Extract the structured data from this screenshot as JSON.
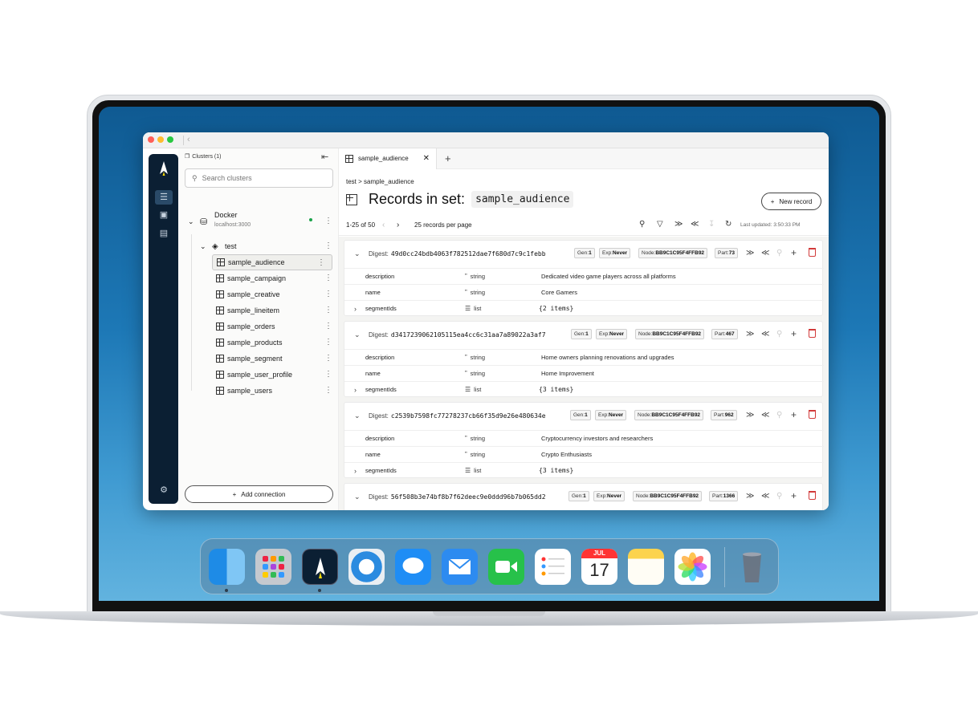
{
  "sidebar": {
    "clusters_label": "Clusters (1)",
    "search_placeholder": "Search clusters",
    "cluster": {
      "name": "Docker",
      "host": "localhost:3000"
    },
    "namespace": "test",
    "sets": [
      "sample_audience",
      "sample_campaign",
      "sample_creative",
      "sample_lineitem",
      "sample_orders",
      "sample_products",
      "sample_segment",
      "sample_user_profile",
      "sample_users"
    ],
    "add_connection": "Add connection"
  },
  "tab": {
    "label": "sample_audience"
  },
  "breadcrumb": "test > sample_audience",
  "header": {
    "title": "Records in set:",
    "set_name": "sample_audience",
    "new_record": "New record"
  },
  "toolbar": {
    "range": "1-25 of 50",
    "per_page": "25 records per page",
    "last_updated": "Last updated: 3:50:33 PM"
  },
  "records": [
    {
      "digest_label": "Digest:",
      "digest": "49d0cc24bdb4063f782512dae7f680d7c9c1febb",
      "gen_label": "Gen:",
      "gen": "1",
      "exp_label": "Exp:",
      "exp": "Never",
      "node_label": "Node:",
      "node": "BB9C1C95F4FFB92",
      "part_label": "Part:",
      "part": "73",
      "bins": [
        {
          "name": "description",
          "type": "string",
          "value": "Dedicated video game players across all platforms"
        },
        {
          "name": "name",
          "type": "string",
          "value": "Core Gamers"
        },
        {
          "name": "segmentIds",
          "type": "list",
          "value": "{2 items}"
        }
      ]
    },
    {
      "digest_label": "Digest:",
      "digest": "d3417239062105115ea4cc6c31aa7a89022a3af7",
      "gen_label": "Gen:",
      "gen": "1",
      "exp_label": "Exp:",
      "exp": "Never",
      "node_label": "Node:",
      "node": "BB9C1C95F4FFB92",
      "part_label": "Part:",
      "part": "467",
      "bins": [
        {
          "name": "description",
          "type": "string",
          "value": "Home owners planning renovations and upgrades"
        },
        {
          "name": "name",
          "type": "string",
          "value": "Home Improvement"
        },
        {
          "name": "segmentIds",
          "type": "list",
          "value": "{3 items}"
        }
      ]
    },
    {
      "digest_label": "Digest:",
      "digest": "c2539b7598fc77278237cb66f35d9e26e480634e",
      "gen_label": "Gen:",
      "gen": "1",
      "exp_label": "Exp:",
      "exp": "Never",
      "node_label": "Node:",
      "node": "BB9C1C95F4FFB92",
      "part_label": "Part:",
      "part": "962",
      "bins": [
        {
          "name": "description",
          "type": "string",
          "value": "Cryptocurrency investors and researchers"
        },
        {
          "name": "name",
          "type": "string",
          "value": "Crypto Enthusiasts"
        },
        {
          "name": "segmentIds",
          "type": "list",
          "value": "{3 items}"
        }
      ]
    },
    {
      "digest_label": "Digest:",
      "digest": "56f508b3e74bf8b7f62deec9e0ddd96b7b065dd2",
      "gen_label": "Gen:",
      "gen": "1",
      "exp_label": "Exp:",
      "exp": "Never",
      "node_label": "Node:",
      "node": "BB9C1C95F4FFB92",
      "part_label": "Part:",
      "part": "1366",
      "bins": []
    }
  ],
  "dock": {
    "calendar_month": "JUL",
    "calendar_day": "17"
  },
  "colors": {
    "rail": "#0b1f33",
    "accent": "#f5d90a",
    "delete": "#d23b3b"
  }
}
